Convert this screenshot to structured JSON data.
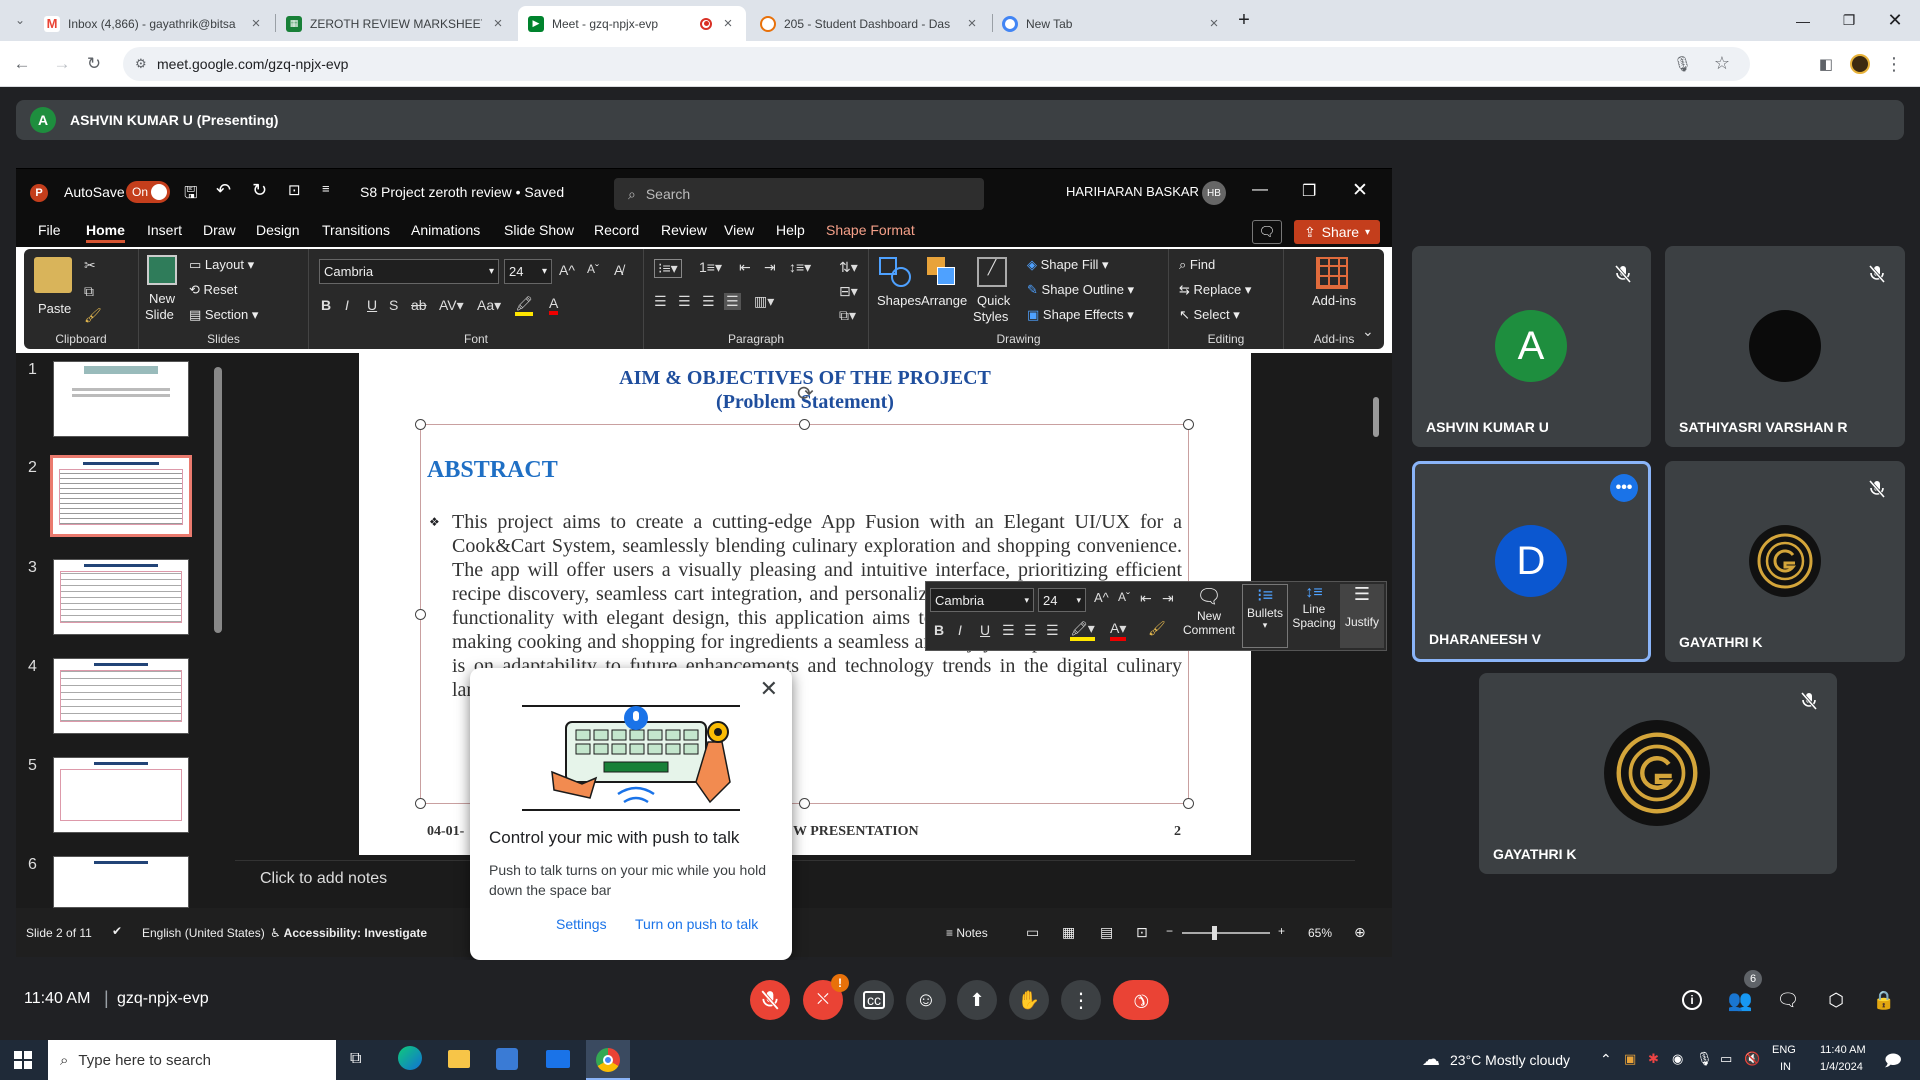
{
  "browser": {
    "tabs": [
      {
        "title": "Inbox (4,866) - gayathrik@bitsa",
        "icon": "gmail"
      },
      {
        "title": "ZEROTH REVIEW MARKSHEET 2",
        "icon": "sheets"
      },
      {
        "title": "Meet - gzq-npjx-evp",
        "icon": "meet"
      },
      {
        "title": "205 - Student Dashboard - Das",
        "icon": "dashboard"
      },
      {
        "title": "New Tab",
        "icon": "chrome"
      }
    ],
    "url": "meet.google.com/gzq-npjx-evp"
  },
  "meet": {
    "presenter_initial": "A",
    "presenter_label": "ASHVIN KUMAR U (Presenting)",
    "time": "11:40 AM",
    "meeting_code": "gzq-npjx-evp",
    "people_count": "6",
    "camera_alert": "!",
    "participants": [
      {
        "name": "ASHVIN KUMAR U",
        "initial": "A",
        "avatar_color": "#1e8e3e"
      },
      {
        "name": "SATHIYASRI VARSHAN R",
        "initial": "",
        "avatar_color": "#0b0b0b"
      },
      {
        "name": "DHARANEESH V",
        "initial": "D",
        "avatar_color": "#0b57d0"
      },
      {
        "name": "GAYATHRI K",
        "initial": "",
        "avatar_color": "#111111"
      },
      {
        "name": "GAYATHRI K",
        "initial": "",
        "avatar_color": "#111111"
      }
    ]
  },
  "ppt": {
    "autosave_label": "AutoSave",
    "autosave_state": "On",
    "doc_title": "S8 Project zeroth review • Saved",
    "search_placeholder": "Search",
    "user_name": "HARIHARAN BASKAR",
    "user_initials": "HB",
    "menus": [
      "File",
      "Home",
      "Insert",
      "Draw",
      "Design",
      "Transitions",
      "Animations",
      "Slide Show",
      "Record",
      "Review",
      "View",
      "Help",
      "Shape Format"
    ],
    "share_label": "Share",
    "ribbon": {
      "clipboard": "Clipboard",
      "paste": "Paste",
      "slides": "Slides",
      "new_slide": "New",
      "new_slide2": "Slide",
      "layout": "Layout",
      "reset": "Reset",
      "section": "Section",
      "font": "Font",
      "font_name": "Cambria",
      "font_size": "24",
      "paragraph": "Paragraph",
      "drawing": "Drawing",
      "shapes": "Shapes",
      "arrange": "Arrange",
      "quick_styles": "Quick",
      "quick_styles2": "Styles",
      "shape_fill": "Shape Fill",
      "shape_outline": "Shape Outline",
      "shape_effects": "Shape Effects",
      "editing": "Editing",
      "find": "Find",
      "replace": "Replace",
      "select": "Select",
      "addins": "Add-ins"
    },
    "thumb_numbers": [
      "1",
      "2",
      "3",
      "4",
      "5",
      "6"
    ],
    "slide": {
      "title1": "AIM & OBJECTIVES OF THE PROJECT",
      "title2": "(Problem Statement)",
      "heading": "ABSTRACT",
      "body": "This project aims to create a cutting-edge App Fusion with an Elegant UI/UX for a Cook&Cart System, seamlessly blending culinary exploration and shopping convenience. The app will offer users a visually pleasing and intuitive interface, prioritizing efficient recipe discovery, seamless cart integration, and personalized user profiles. By combining functionality with elegant design, this application aims to redefine the user experience, making cooking and shopping for ingredients a seamless and enjoyable process. The focus is on adaptability to future enhancements and technology trends in the digital culinary landscape.",
      "footer_left": "04-01-",
      "footer_mid": "W PRESENTATION",
      "footer_num": "2"
    },
    "mini_toolbar": {
      "font": "Cambria",
      "size": "24",
      "new_comment": "New",
      "new_comment2": "Comment",
      "bullets": "Bullets",
      "line_spacing": "Line",
      "line_spacing2": "Spacing",
      "justify": "Justify"
    },
    "notes_placeholder": "Click to add notes",
    "status": {
      "slide_of": "Slide 2 of 11",
      "language": "English (United States)",
      "accessibility": "Accessibility: Investigate",
      "notes": "Notes",
      "zoom": "65%"
    }
  },
  "ptt_popup": {
    "title": "Control your mic with push to talk",
    "body": "Push to talk turns on your mic while you hold down the space bar",
    "settings": "Settings",
    "turn_on": "Turn on push to talk"
  },
  "taskbar": {
    "search_placeholder": "Type here to search",
    "weather": "23°C  Mostly cloudy",
    "lang1": "ENG",
    "lang2": "IN",
    "time": "11:40 AM",
    "date": "1/4/2024"
  }
}
